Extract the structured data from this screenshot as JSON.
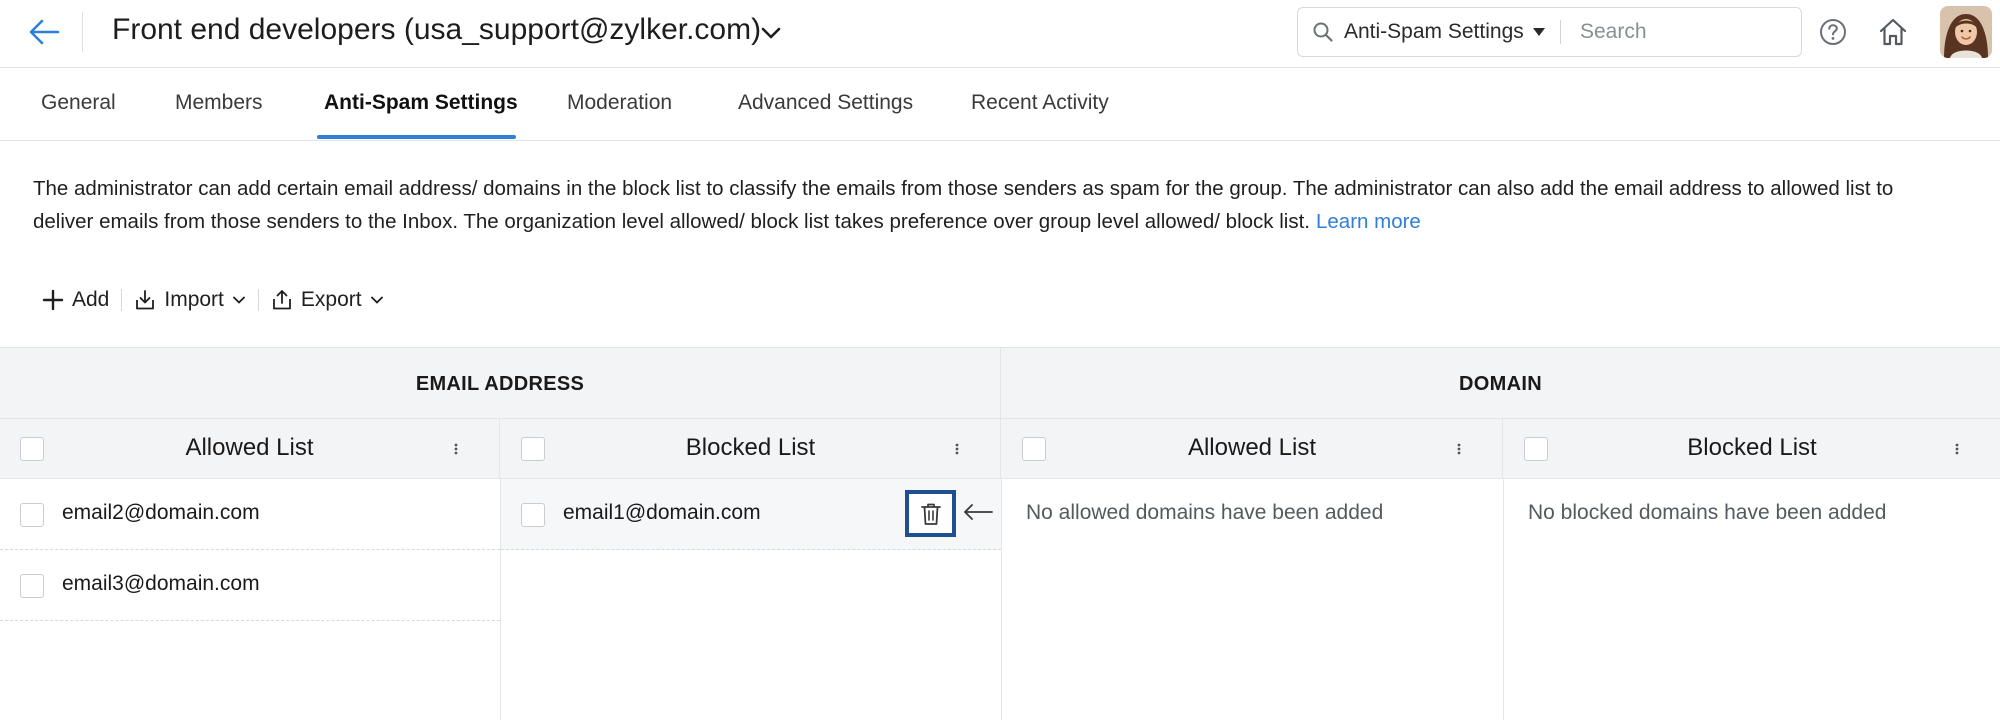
{
  "header": {
    "title": "Front end developers (usa_support@zylker.com)",
    "search": {
      "scope": "Anti-Spam Settings",
      "placeholder": "Search"
    }
  },
  "tabs": [
    {
      "label": "General",
      "active": false
    },
    {
      "label": "Members",
      "active": false
    },
    {
      "label": "Anti-Spam Settings",
      "active": true
    },
    {
      "label": "Moderation",
      "active": false
    },
    {
      "label": "Advanced Settings",
      "active": false
    },
    {
      "label": "Recent Activity",
      "active": false
    }
  ],
  "description": {
    "line1": "The administrator can add certain email address/ domains in the block list to classify the emails from those senders as spam for the group. The administrator can also add the email address to allowed list to",
    "line2": "deliver emails from those senders to the Inbox. The organization level allowed/ block list takes preference over group level allowed/ block list.",
    "learn_more": "Learn more"
  },
  "toolbar": {
    "add": "Add",
    "import": "Import",
    "export": "Export"
  },
  "grid": {
    "email_group": "EMAIL ADDRESS",
    "domain_group": "DOMAIN",
    "email_allowed": {
      "title": "Allowed List",
      "items": [
        "email2@domain.com",
        "email3@domain.com"
      ]
    },
    "email_blocked": {
      "title": "Blocked List",
      "items": [
        "email1@domain.com"
      ]
    },
    "domain_allowed": {
      "title": "Allowed List",
      "empty": "No allowed domains have been added"
    },
    "domain_blocked": {
      "title": "Blocked List",
      "empty": "No blocked domains have been added"
    }
  },
  "colors": {
    "accent": "#2f7fd6",
    "highlight_border": "#1d4f91",
    "header_bg": "#f3f4f6"
  }
}
